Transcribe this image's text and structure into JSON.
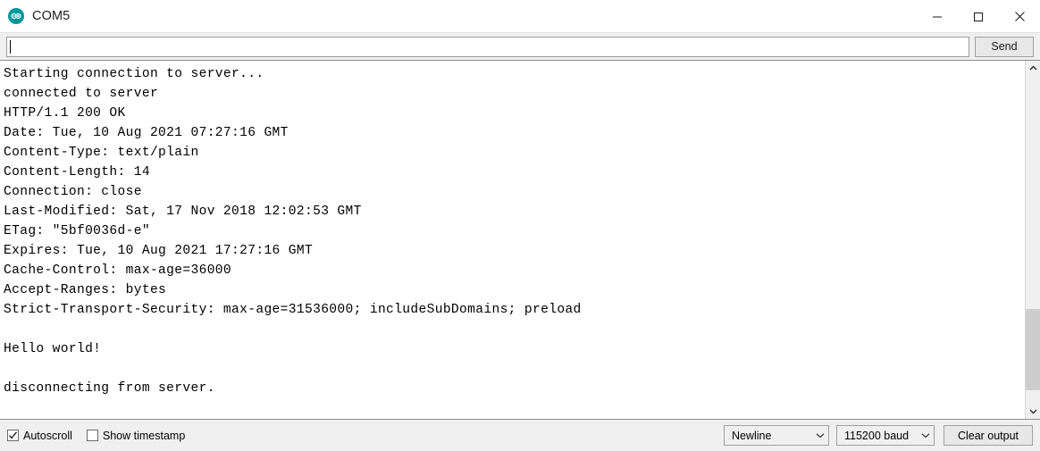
{
  "titlebar": {
    "title": "COM5",
    "logo_icon": "arduino-logo-icon",
    "minimize_label": "Minimize",
    "maximize_label": "Maximize",
    "close_label": "Close"
  },
  "send_row": {
    "input_value": "",
    "input_placeholder": "",
    "send_label": "Send"
  },
  "console": {
    "lines": [
      "Starting connection to server...",
      "connected to server",
      "HTTP/1.1 200 OK",
      "Date: Tue, 10 Aug 2021 07:27:16 GMT",
      "Content-Type: text/plain",
      "Content-Length: 14",
      "Connection: close",
      "Last-Modified: Sat, 17 Nov 2018 12:02:53 GMT",
      "ETag: \"5bf0036d-e\"",
      "Expires: Tue, 10 Aug 2021 17:27:16 GMT",
      "Cache-Control: max-age=36000",
      "Accept-Ranges: bytes",
      "Strict-Transport-Security: max-age=31536000; includeSubDomains; preload",
      "",
      "Hello world!",
      "",
      "disconnecting from server."
    ]
  },
  "scrollbar": {
    "up_icon": "chevron-up-icon",
    "down_icon": "chevron-down-icon",
    "thumb_top_percent": 71,
    "thumb_height_percent": 25
  },
  "bottombar": {
    "autoscroll_label": "Autoscroll",
    "autoscroll_checked": true,
    "show_timestamp_label": "Show timestamp",
    "show_timestamp_checked": false,
    "line_ending_value": "Newline",
    "baud_value": "115200 baud",
    "clear_output_label": "Clear output"
  },
  "colors": {
    "accent": "#00979c",
    "titlebar_bg": "#ffffff",
    "chrome_bg": "#f0f0f0",
    "console_bg": "#ffffff",
    "console_fg": "#000000"
  }
}
